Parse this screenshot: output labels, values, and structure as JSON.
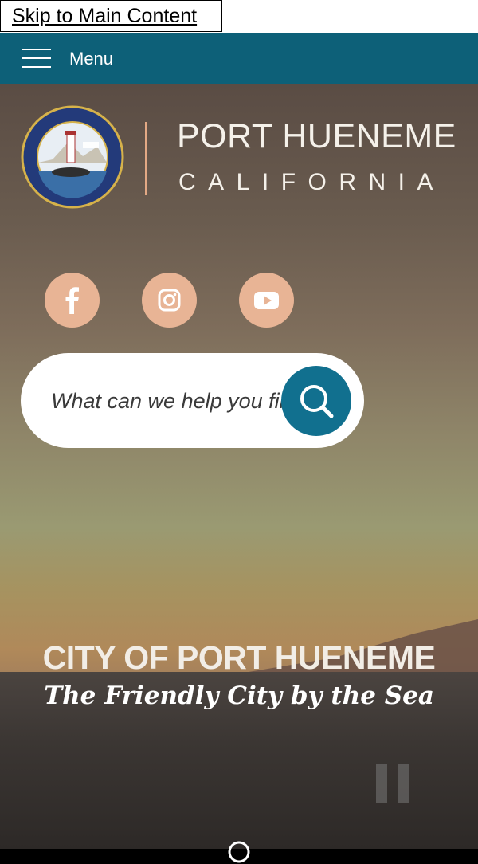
{
  "skip_link": {
    "label": "Skip to Main Content"
  },
  "menu": {
    "label": "Menu"
  },
  "brand": {
    "title": "PORT HUENEME",
    "subtitle": "CALIFORNIA"
  },
  "social": [
    {
      "name": "facebook",
      "icon": "facebook-icon"
    },
    {
      "name": "instagram",
      "icon": "instagram-icon"
    },
    {
      "name": "youtube",
      "icon": "youtube-icon"
    }
  ],
  "search": {
    "placeholder": "What can we help you find?",
    "value": ""
  },
  "hero": {
    "title": "CITY OF PORT HUENEME",
    "tagline": "The Friendly City by the Sea"
  },
  "colors": {
    "menu_bar": "#0d6078",
    "social_bg": "#e8b495",
    "search_button": "#11708f",
    "divider": "#e3a985"
  }
}
